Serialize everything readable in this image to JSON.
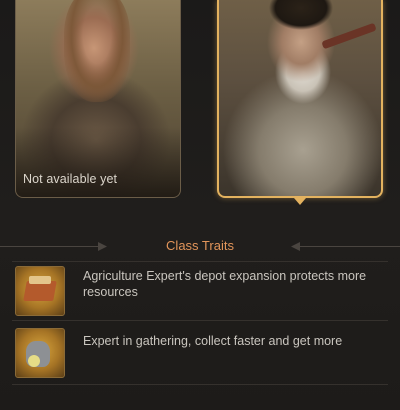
{
  "cards": [
    {
      "caption": "Not available yet",
      "selected": false
    },
    {
      "caption": "",
      "selected": true
    }
  ],
  "section": {
    "title": "Class Traits"
  },
  "traits": [
    {
      "icon": "depot-icon",
      "text": "Agriculture Expert's depot expansion protects more resources"
    },
    {
      "icon": "gathering-icon",
      "text": "Expert in gathering, collect faster and get more"
    }
  ],
  "colors": {
    "accent": "#e2955a",
    "selected_border": "#e3b25f",
    "text": "#c9c5be"
  }
}
